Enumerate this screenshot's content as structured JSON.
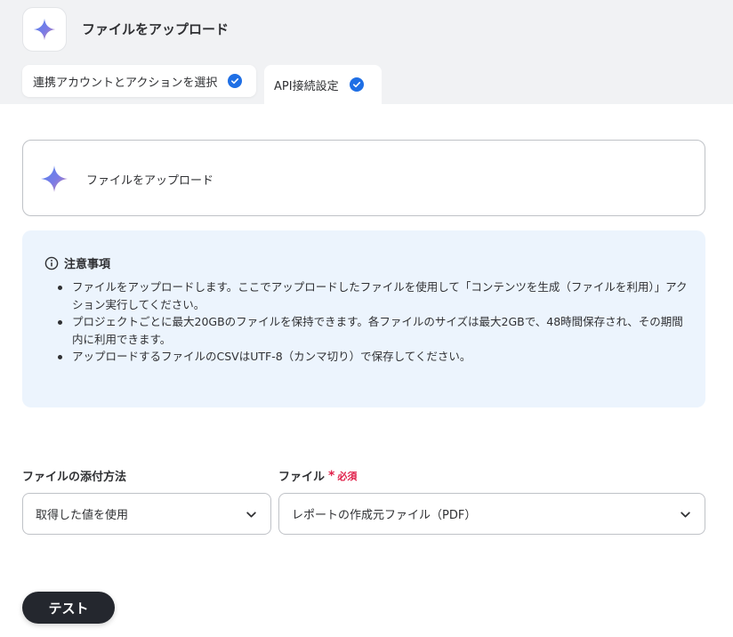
{
  "header": {
    "app_icon": "sparkle-icon",
    "title": "ファイルをアップロード"
  },
  "steps": [
    {
      "label": "連携アカウントとアクションを選択",
      "completed": true,
      "icon": "check-circle-icon"
    },
    {
      "label": "API接続設定",
      "completed": true,
      "active": true,
      "icon": "check-circle-icon"
    }
  ],
  "action_card": {
    "icon": "sparkle-icon",
    "label": "ファイルをアップロード"
  },
  "notice": {
    "icon": "info-icon",
    "title": "注意事項",
    "items": [
      "ファイルをアップロードします。ここでアップロードしたファイルを使用して「コンテンツを生成（ファイルを利用）」アクション実行してください。",
      "プロジェクトごとに最大20GBのファイルを保持できます。各ファイルのサイズは最大2GBで、48時間保存され、その期間内に利用できます。",
      "アップロードするファイルのCSVはUTF-8（カンマ切り）で保存してください。"
    ]
  },
  "fields": {
    "attach_method": {
      "label": "ファイルの添付方法",
      "value": "取得した値を使用"
    },
    "file": {
      "label": "ファイル",
      "required_mark": "*",
      "required_text": "必須",
      "value": "レポートの作成元ファイル（PDF）"
    }
  },
  "test_button": {
    "label": "テスト"
  },
  "colors": {
    "accent": "#1f6fe5",
    "required": "#e0204a",
    "notice_bg": "#ecf4fd",
    "button_bg": "#24272e"
  }
}
